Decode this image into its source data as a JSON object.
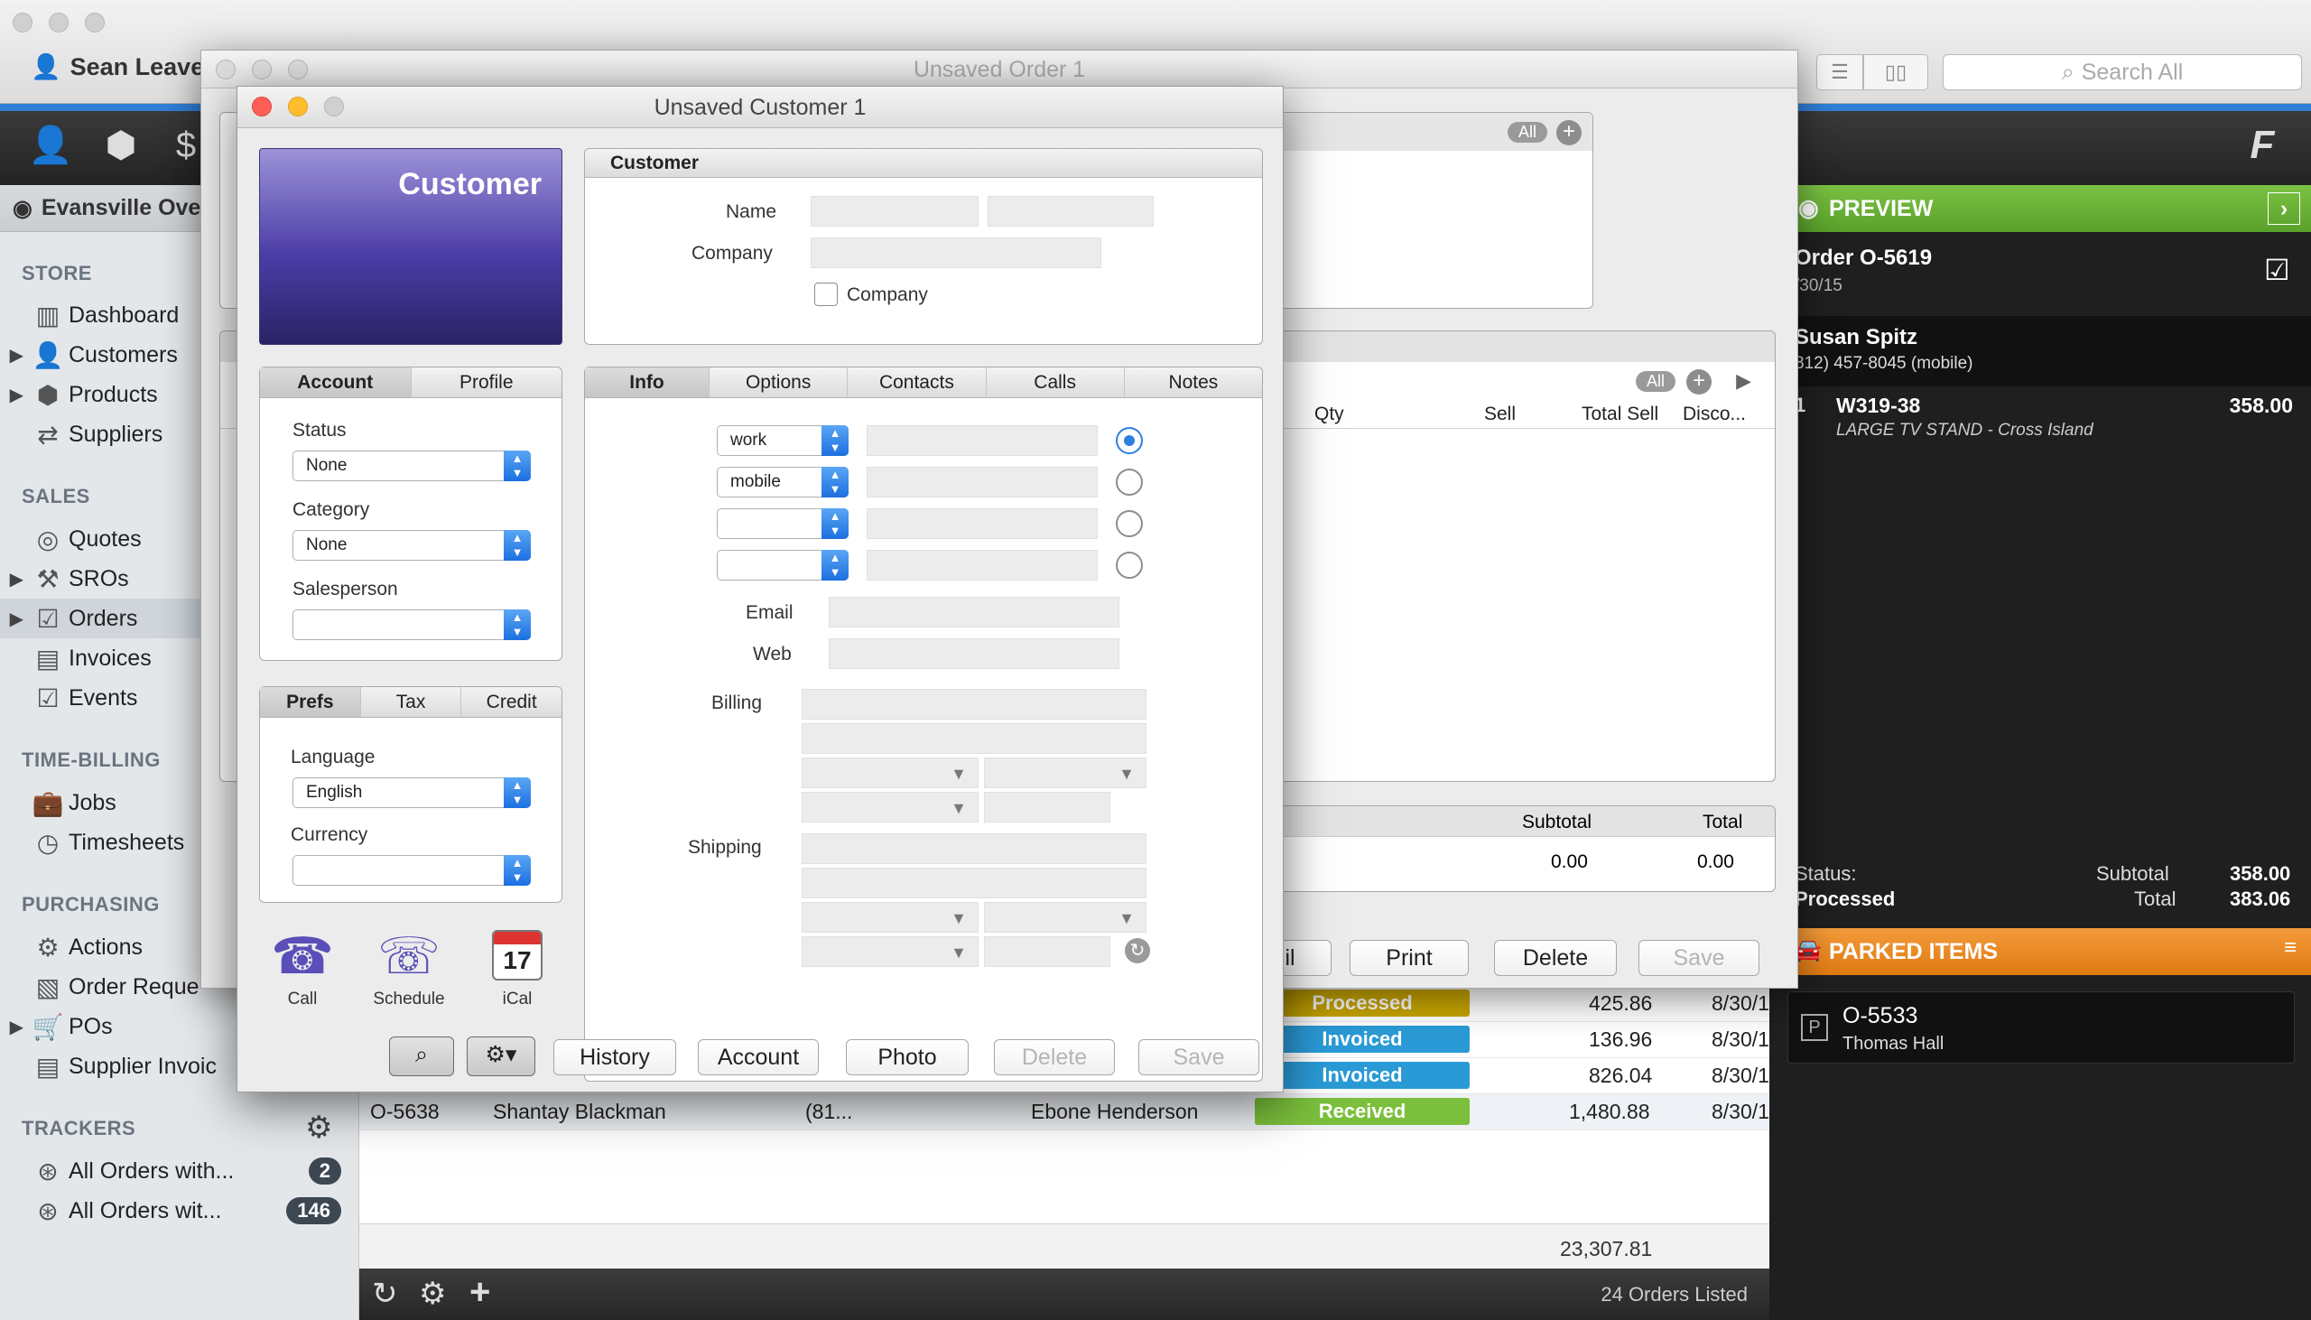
{
  "main_window": {
    "user_name": "Sean Leave",
    "search_placeholder": "Search All",
    "sidebar_header": "Evansville Over",
    "sections": {
      "store": "STORE",
      "sales": "SALES",
      "time_billing": "TIME-BILLING",
      "purchasing": "PURCHASING",
      "trackers": "TRACKERS"
    },
    "store_items": [
      "Dashboard",
      "Customers",
      "Products",
      "Suppliers"
    ],
    "sales_items": [
      "Quotes",
      "SROs",
      "Orders",
      "Invoices",
      "Events"
    ],
    "time_billing_items": [
      "Jobs",
      "Timesheets"
    ],
    "purchasing_items": [
      "Actions",
      "Order Reque",
      "POs",
      "Supplier Invoic"
    ],
    "trackers": [
      {
        "label": "All Orders with...",
        "count": "2"
      },
      {
        "label": "All Orders wit...",
        "count": "146"
      }
    ],
    "rows": [
      {
        "status": "Processed",
        "status_color": "#c9a600",
        "amount": "425.86",
        "date": "8/30/1"
      },
      {
        "status": "Invoiced",
        "status_color": "#2a9ad6",
        "amount": "136.96",
        "date": "8/30/1"
      },
      {
        "status": "Invoiced",
        "status_color": "#2a9ad6",
        "amount": "826.04",
        "date": "8/30/1"
      },
      {
        "order": "O-5638",
        "customer": "Shantay Blackman",
        "phone": "(81...",
        "salesperson": "Ebone Henderson",
        "status": "Received",
        "status_color": "#7bbf3c",
        "amount": "1,480.88",
        "date": "8/30/1"
      }
    ],
    "total": "23,307.81",
    "orders_listed": "24 Orders Listed"
  },
  "preview": {
    "header": "PREVIEW",
    "order_title": "Order O-5619",
    "order_date": "/30/15",
    "customer_name": "Susan Spitz",
    "customer_phone": "812) 457-8045 (mobile)",
    "line_qty": "1",
    "line_sku": "W319-38",
    "line_desc": "LARGE TV STAND -  Cross Island",
    "line_amount": "358.00",
    "status_label": "Status:",
    "status_value": "Processed",
    "subtotal_label": "Subtotal",
    "subtotal_value": "358.00",
    "total_label": "Total",
    "total_value": "383.06",
    "parked_header": "PARKED ITEMS",
    "parked_order": "O-5533",
    "parked_customer": "Thomas Hall"
  },
  "order_window": {
    "title": "Unsaved Order 1",
    "all_badge": "All",
    "columns": [
      "Qty",
      "Sell",
      "Total Sell",
      "Disco..."
    ],
    "subtotal_label": "Subtotal",
    "total_label": "Total",
    "subtotal_value": "0.00",
    "total_value": "0.00",
    "buttons": {
      "partial": "il",
      "print": "Print",
      "delete": "Delete",
      "save": "Save"
    }
  },
  "customer_window": {
    "title": "Unsaved Customer 1",
    "banner": "Customer",
    "customer_panel": "Customer",
    "name_label": "Name",
    "company_label": "Company",
    "company_checkbox": "Company",
    "account_tabs": [
      "Account",
      "Profile"
    ],
    "status_label": "Status",
    "status_value": "None",
    "category_label": "Category",
    "category_value": "None",
    "salesperson_label": "Salesperson",
    "prefs_tabs": [
      "Prefs",
      "Tax",
      "Credit"
    ],
    "language_label": "Language",
    "language_value": "English",
    "currency_label": "Currency",
    "info_tabs": [
      "Info",
      "Options",
      "Contacts",
      "Calls",
      "Notes"
    ],
    "phones": [
      "work",
      "mobile",
      "",
      ""
    ],
    "email_label": "Email",
    "web_label": "Web",
    "billing_label": "Billing",
    "shipping_label": "Shipping",
    "actions": [
      "Call",
      "Schedule",
      "iCal"
    ],
    "ical_day": "17",
    "buttons": {
      "history": "History",
      "account": "Account",
      "photo": "Photo",
      "delete": "Delete",
      "save": "Save"
    }
  }
}
